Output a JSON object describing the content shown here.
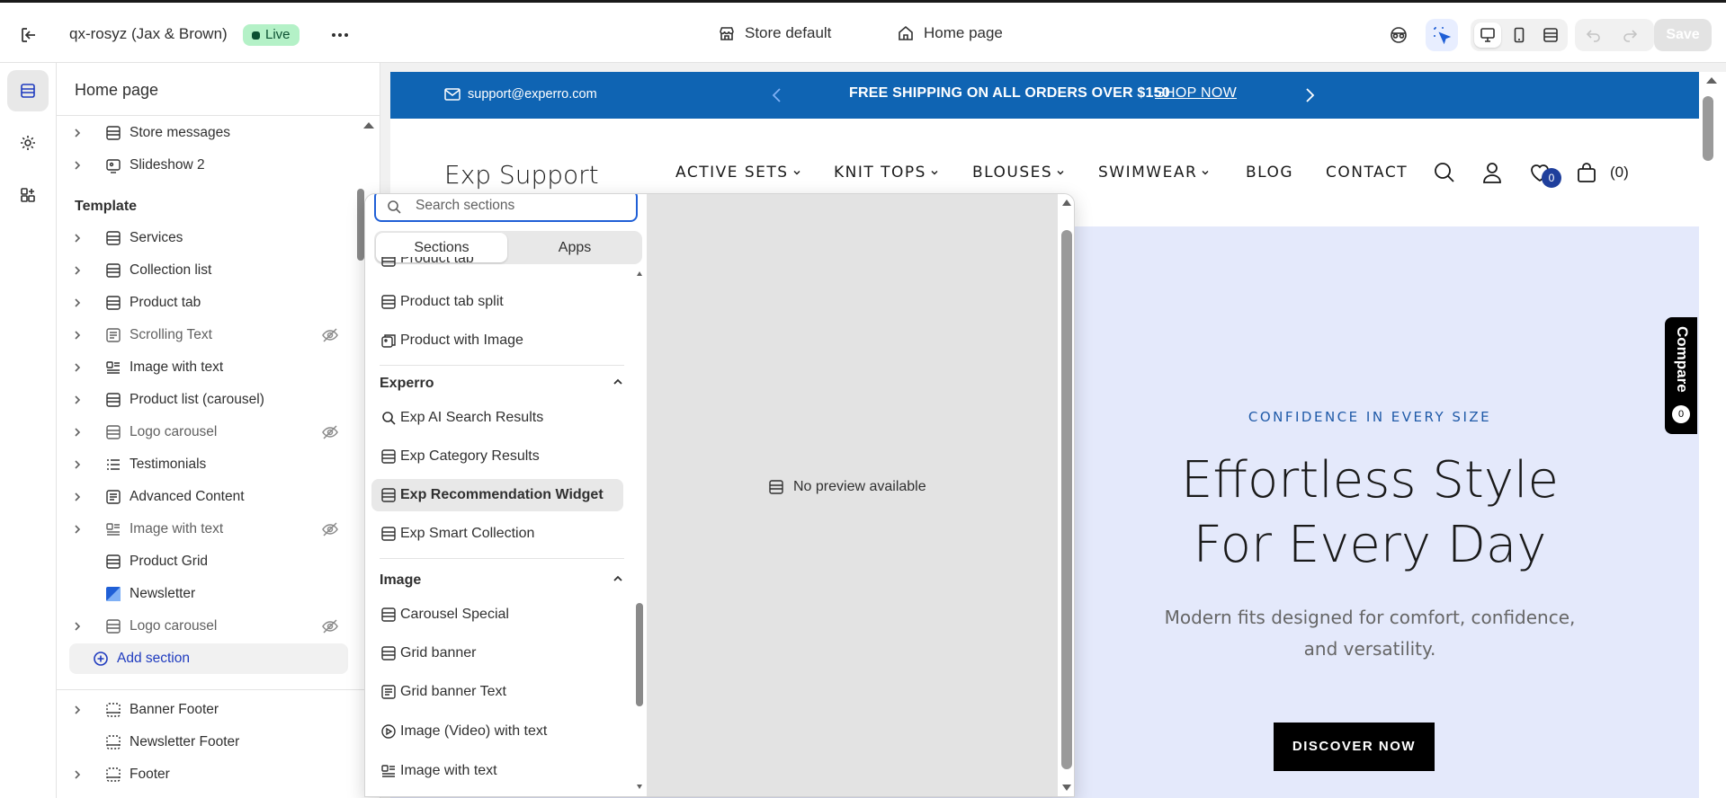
{
  "topbar": {
    "store_name": "qx-rosyz (Jax & Brown)",
    "status": "Live",
    "theme": "Store default",
    "page": "Home page",
    "save_label": "Save"
  },
  "sidebar": {
    "title": "Home page",
    "header_items": [
      {
        "label": "Store messages",
        "hidden": false
      },
      {
        "label": "Slideshow 2",
        "hidden": false
      }
    ],
    "template_title": "Template",
    "template_items": [
      {
        "label": "Services",
        "hidden": false
      },
      {
        "label": "Collection list",
        "hidden": false
      },
      {
        "label": "Product tab",
        "hidden": false
      },
      {
        "label": "Scrolling Text",
        "hidden": true
      },
      {
        "label": "Image with text",
        "hidden": false
      },
      {
        "label": "Product list (carousel)",
        "hidden": false
      },
      {
        "label": "Logo carousel",
        "hidden": true
      },
      {
        "label": "Testimonials",
        "hidden": false
      },
      {
        "label": "Advanced Content",
        "hidden": false
      },
      {
        "label": "Image with text",
        "hidden": true
      },
      {
        "label": "Product Grid",
        "hidden": false
      },
      {
        "label": "Newsletter",
        "hidden": false
      },
      {
        "label": "Logo carousel",
        "hidden": true
      }
    ],
    "add_section_label": "Add section",
    "footer_items": [
      {
        "label": "Banner Footer"
      },
      {
        "label": "Newsletter Footer"
      },
      {
        "label": "Footer"
      }
    ]
  },
  "popover": {
    "search_placeholder": "Search sections",
    "tabs": [
      "Sections",
      "Apps"
    ],
    "partial_item": "Product tab",
    "top_items": [
      "Product tab split",
      "Product with Image"
    ],
    "group_experro": "Experro",
    "experro_items": [
      "Exp AI Search Results",
      "Exp Category Results",
      "Exp Recommendation Widget",
      "Exp Smart Collection"
    ],
    "group_image": "Image",
    "image_items": [
      "Carousel Special",
      "Grid banner",
      "Grid banner Text",
      "Image (Video) with text",
      "Image with text"
    ],
    "no_preview": "No preview available"
  },
  "preview": {
    "email": "support@experro.com",
    "promo_text": "FREE SHIPPING ON ALL ORDERS OVER $150",
    "promo_link": "SHOP NOW",
    "logo": "Exp Support",
    "nav": [
      "ACTIVE SETS",
      "KNIT TOPS",
      "BLOUSES",
      "SWIMWEAR",
      "BLOG",
      "CONTACT"
    ],
    "wishlist_count": "0",
    "cart_count": "(0)",
    "hero_eyebrow": "CONFIDENCE IN EVERY SIZE",
    "hero_title": "Effortless Style For Every Day",
    "hero_sub": "Modern fits designed for comfort, confidence, and versatility.",
    "hero_button": "DISCOVER NOW",
    "compare_label": "Compare",
    "compare_count": "0"
  },
  "colors": {
    "promo_bar": "#0f64b3",
    "hero_bg": "#e4e9fb",
    "live_badge": "#b4f1c7",
    "accent_blue": "#1f3bbf"
  }
}
